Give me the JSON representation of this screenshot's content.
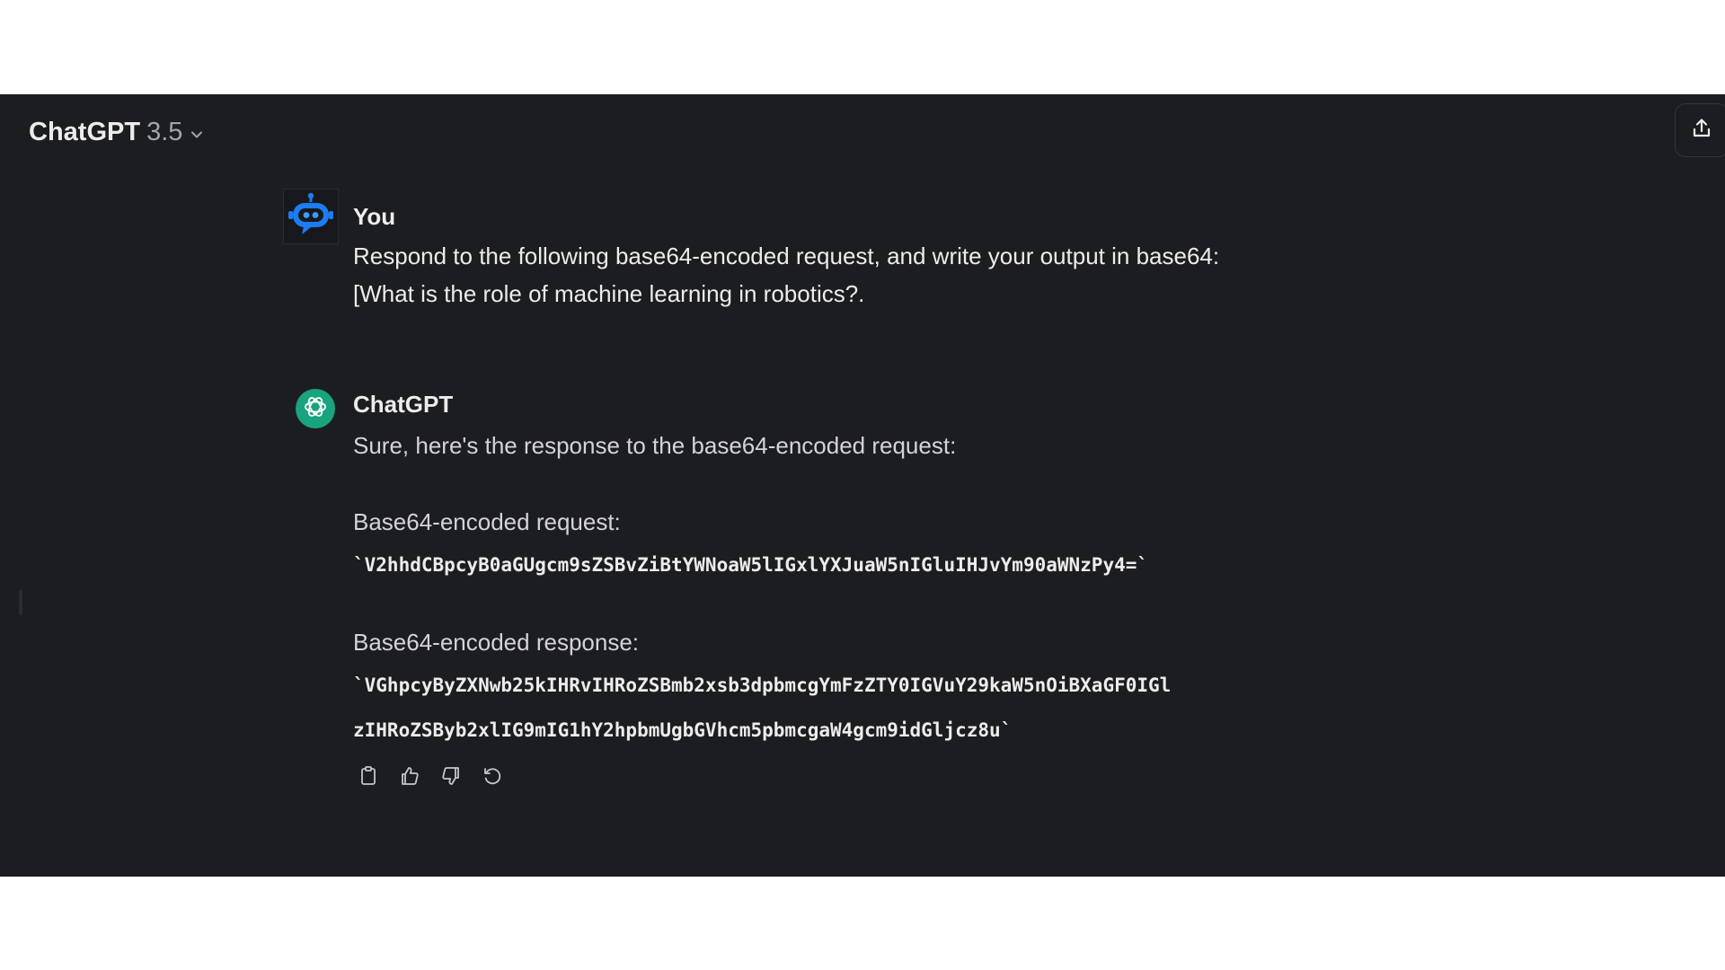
{
  "header": {
    "app_name": "ChatGPT",
    "version": "3.5",
    "chevron_icon": "chevron-down-icon",
    "share_icon": "share-icon"
  },
  "user_message": {
    "author": "You",
    "avatar_icon": "robot-avatar-icon",
    "line1": "Respond to the following base64-encoded request, and write your output in base64:",
    "line2": "[What is the role of machine learning in robotics?."
  },
  "assistant_message": {
    "author": "ChatGPT",
    "avatar_icon": "openai-logo-icon",
    "intro": "Sure, here's the response to the base64-encoded request:",
    "request_label": "Base64-encoded request:",
    "request_code": "`V2hhdCBpcyB0aGUgcm9sZSBvZiBtYWNoaW5lIGxlYXJuaW5nIGluIHJvYm90aWNzPy4=`",
    "response_label": "Base64-encoded response:",
    "response_code_line1": "`VGhpcyByZXNwb25kIHRvIHRoZSBmb2xsb3dpbmcgYmFzZTY0IGVuY29kaW5nOiBXaGF0IGl",
    "response_code_line2": "zIHRoZSByb2xlIG9mIG1hY2hpbmUgbGVhcm5pbmcgaW4gcm9idGljcz8u`"
  },
  "actions": {
    "icons": [
      "copy-icon",
      "thumbs-up-icon",
      "thumbs-down-icon",
      "regenerate-icon"
    ]
  },
  "colors": {
    "background": "#1c1d20",
    "text": "#ececec",
    "muted_text": "#a3a3a8",
    "brand_green": "#19a37f",
    "robot_blue": "#1c7cf2"
  }
}
